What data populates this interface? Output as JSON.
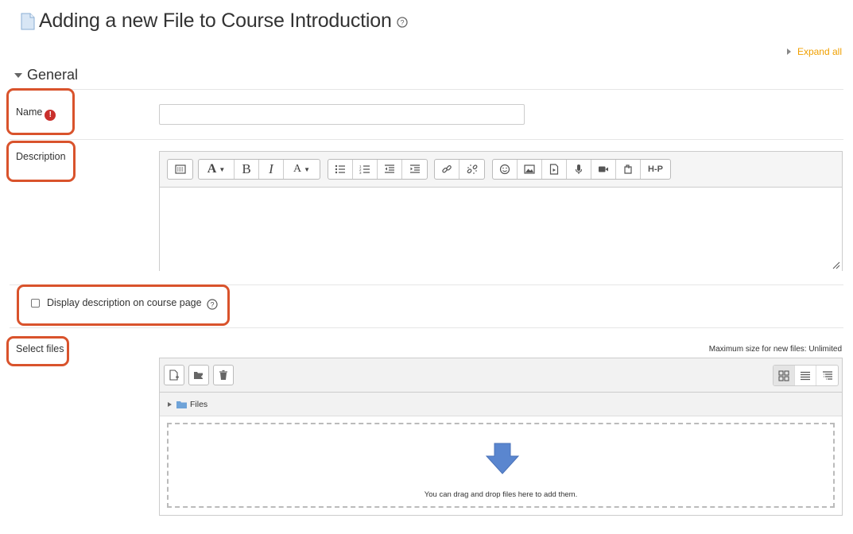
{
  "page": {
    "title": "Adding a new File to Course Introduction",
    "expand_all": "Expand all",
    "section_title": "General"
  },
  "form": {
    "name_label": "Name",
    "name_value": "",
    "description_label": "Description",
    "display_description_label": "Display description on course page",
    "display_description_checked": false,
    "select_files_label": "Select files",
    "max_size_text": "Maximum size for new files: Unlimited"
  },
  "editor": {
    "toolbar_groups": [
      [
        "collapse-icon"
      ],
      [
        "font-size-icon",
        "bold-icon",
        "italic-icon",
        "text-style-icon"
      ],
      [
        "unordered-list-icon",
        "ordered-list-icon",
        "outdent-icon",
        "indent-icon"
      ],
      [
        "link-icon",
        "unlink-icon"
      ],
      [
        "emoji-icon",
        "image-icon",
        "media-icon",
        "record-audio-icon",
        "record-video-icon",
        "manage-files-icon",
        "h5p-icon"
      ]
    ],
    "h5p_label": "H-P"
  },
  "filemanager": {
    "path_label": "Files",
    "drop_message": "You can drag and drop files here to add them.",
    "toolbar": [
      "add-file-icon",
      "create-folder-icon",
      "delete-icon"
    ],
    "views": [
      "grid-view-icon",
      "list-view-icon",
      "tree-view-icon"
    ],
    "active_view": "grid-view-icon"
  },
  "colors": {
    "highlight": "#d9532c",
    "required": "#c9302c",
    "link": "#f0a000"
  }
}
